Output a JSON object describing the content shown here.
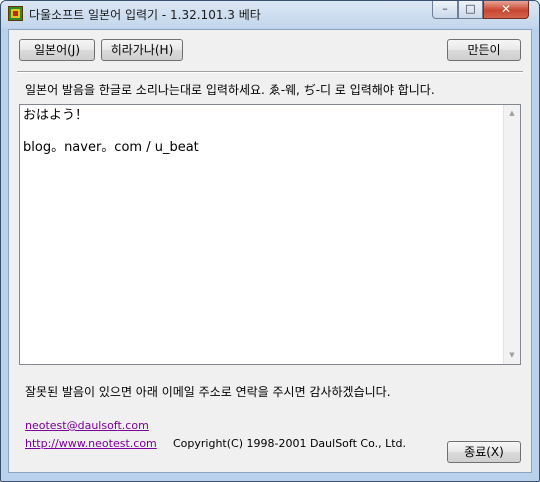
{
  "window": {
    "title": "다울소프트 일본어 입력기 - 1.32.101.3 베타",
    "controls": {
      "minimize": "–",
      "maximize": "□",
      "close": "✕"
    }
  },
  "toolbar": {
    "japanese_button": "일본어(J)",
    "hiragana_button": "히라가나(H)",
    "credits_button": "만든이"
  },
  "instruction": "일본어 발음을 한글로 소리나는대로 입력하세요.  ゑ-웨, ぢ-디 로 입력해야 합니다.",
  "editor": {
    "lines": [
      "おはよう！",
      "",
      "blog。naver。com / u_beat"
    ],
    "scroll_up": "▲",
    "scroll_down": "▼"
  },
  "notice": "잘못된 발음이 있으면 아래 이메일 주소로 연락을 주시면 감사하겠습니다.",
  "footer": {
    "email": "neotest@daulsoft.com",
    "url": "http://www.neotest.com",
    "copyright": "Copyright(C) 1998-2001 DaulSoft Co., Ltd.",
    "quit_button": "종료(X)"
  },
  "colors": {
    "link_visited": "#7a0099",
    "close_button": "#c9462f",
    "titlebar": "#c3d6ec"
  }
}
